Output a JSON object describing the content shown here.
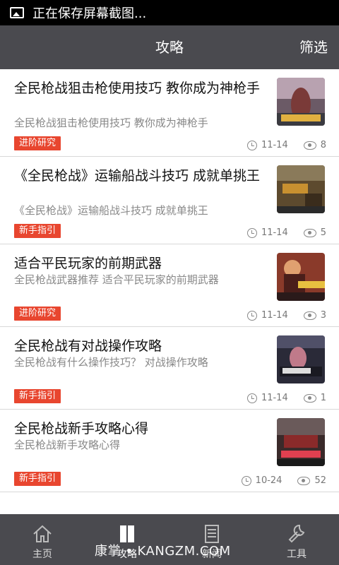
{
  "status": {
    "text": "正在保存屏幕截图..."
  },
  "header": {
    "title": "攻略",
    "filter": "筛选"
  },
  "articles": [
    {
      "title": "全民枪战狙击枪使用技巧 教你成为神枪手",
      "summary": "全民枪战狙击枪使用技巧 教你成为神枪手",
      "tag": "进阶研究",
      "date": "11-14",
      "views": "8"
    },
    {
      "title": "《全民枪战》运输船战斗技巧 成就单挑王",
      "summary": "《全民枪战》运输船战斗技巧 成就单挑王",
      "tag": "新手指引",
      "date": "11-14",
      "views": "5"
    },
    {
      "title": "适合平民玩家的前期武器",
      "summary": "全民枪战武器推荐 适合平民玩家的前期武器",
      "tag": "进阶研究",
      "date": "11-14",
      "views": "3"
    },
    {
      "title": "全民枪战有对战操作攻略",
      "summary": "全民枪战有什么操作技巧？ 对战操作攻略",
      "tag": "新手指引",
      "date": "11-14",
      "views": "1"
    },
    {
      "title": "全民枪战新手攻略心得",
      "summary": "全民枪战新手攻略心得",
      "tag": "新手指引",
      "date": "10-24",
      "views": "52"
    }
  ],
  "tabs": [
    {
      "label": "主页",
      "icon": "home-icon"
    },
    {
      "label": "攻略",
      "icon": "book-icon"
    },
    {
      "label": "新闻",
      "icon": "news-icon"
    },
    {
      "label": "工具",
      "icon": "wrench-icon"
    }
  ],
  "watermark": "康掌 • KANGZM.COM",
  "colors": {
    "tag": "#e8462f",
    "bar": "#4a4a4f"
  }
}
